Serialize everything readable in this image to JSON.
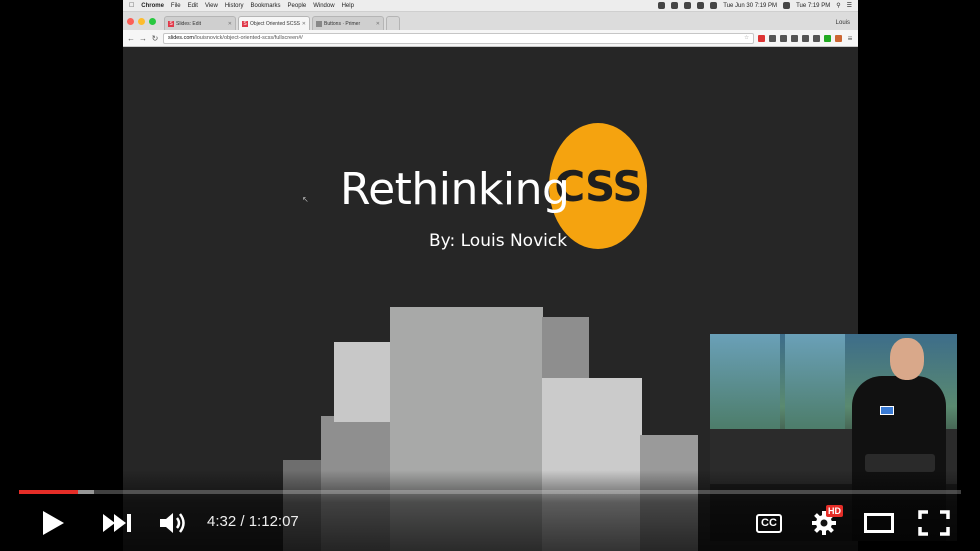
{
  "mac_menubar": {
    "app_name": "Chrome",
    "menus": [
      "File",
      "Edit",
      "View",
      "History",
      "Bookmarks",
      "People",
      "Window",
      "Help"
    ],
    "clock_1": "Tue Jun 30  7:19 PM",
    "clock_2": "Tue 7:19 PM"
  },
  "browser": {
    "tabs": [
      {
        "label": "Slides: Edit",
        "favicon": "S"
      },
      {
        "label": "Object Oriented SCSS · Sli",
        "favicon": "S"
      },
      {
        "label": "Buttons · Primer",
        "favicon": ""
      }
    ],
    "profile_name": "Louis",
    "url_domain": "slides.com",
    "url_path": "/louisnovick/object-oriented-scss/fullscreen#/"
  },
  "slide": {
    "title": "Rethinking",
    "highlight": "CSS",
    "byline": "By: Louis Novick",
    "accent_color": "#f5a30f"
  },
  "player": {
    "current_time": "4:32",
    "separator": " / ",
    "duration": "1:12:07",
    "played_fraction": 0.063,
    "buffered_fraction": 0.08,
    "cc_label": "CC",
    "hd_label": "HD",
    "progress_color": "#e52d27"
  }
}
